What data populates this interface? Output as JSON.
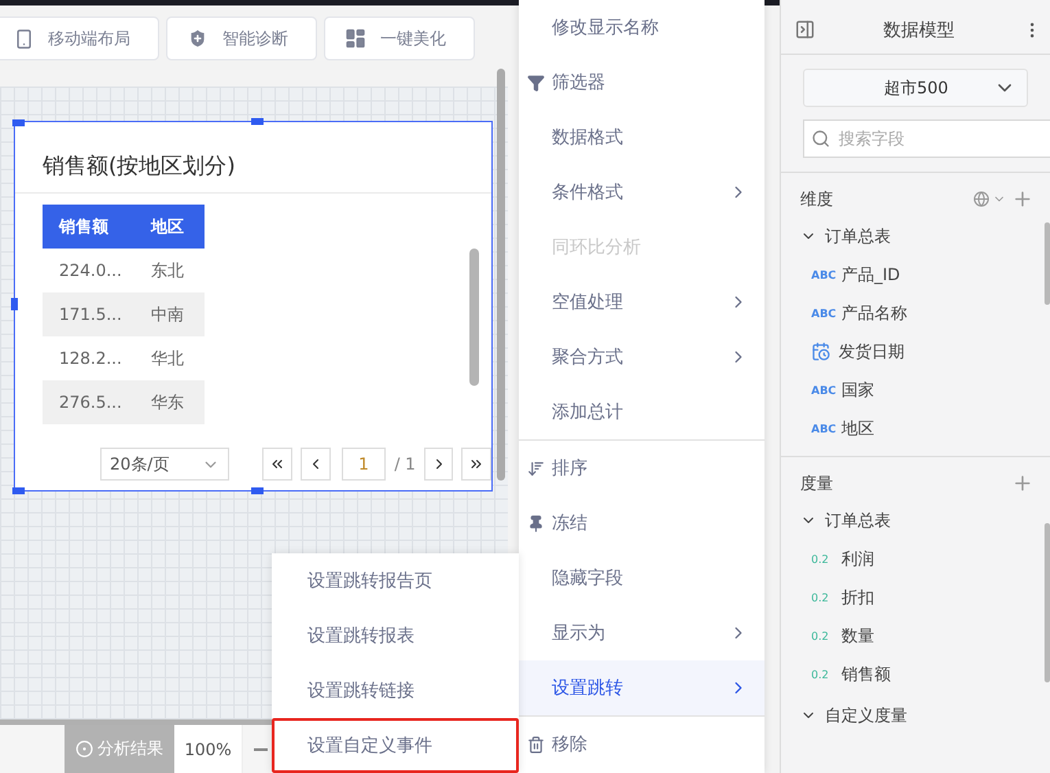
{
  "toolbar": {
    "buttons": [
      {
        "label": "移动端布局",
        "kind": "phone"
      },
      {
        "label": "智能诊断",
        "kind": "shield"
      },
      {
        "label": "一键美化",
        "kind": "layout"
      }
    ]
  },
  "card": {
    "title": "销售额(按地区划分)",
    "columns": [
      "销售额",
      "地区"
    ],
    "rows": [
      [
        "224.0...",
        "东北"
      ],
      [
        "171.5...",
        "中南"
      ],
      [
        "128.2...",
        "华北"
      ],
      [
        "276.5...",
        "华东"
      ]
    ],
    "pagination": {
      "page_size": "20条/页",
      "page": "1",
      "total": "/ 1"
    }
  },
  "bottom_bar": {
    "analysis": "分析结果",
    "zoom": "100%"
  },
  "menu": {
    "groups": [
      [
        {
          "label": "修改显示名称",
          "kind": "plain",
          "submenu": false,
          "disabled": false,
          "selected": false
        },
        {
          "label": "筛选器",
          "kind": "filter",
          "submenu": false,
          "disabled": false,
          "selected": false
        },
        {
          "label": "数据格式",
          "kind": "plain",
          "submenu": false,
          "disabled": false,
          "selected": false
        },
        {
          "label": "条件格式",
          "kind": "plain",
          "submenu": true,
          "disabled": false,
          "selected": false
        },
        {
          "label": "同环比分析",
          "kind": "plain",
          "submenu": false,
          "disabled": true,
          "selected": false
        },
        {
          "label": "空值处理",
          "kind": "plain",
          "submenu": true,
          "disabled": false,
          "selected": false
        },
        {
          "label": "聚合方式",
          "kind": "plain",
          "submenu": true,
          "disabled": false,
          "selected": false
        },
        {
          "label": "添加总计",
          "kind": "plain",
          "submenu": false,
          "disabled": false,
          "selected": false
        }
      ],
      [
        {
          "label": "排序",
          "kind": "sort",
          "submenu": false,
          "disabled": false,
          "selected": false
        },
        {
          "label": "冻结",
          "kind": "pin",
          "submenu": false,
          "disabled": false,
          "selected": false
        },
        {
          "label": "隐藏字段",
          "kind": "plain",
          "submenu": false,
          "disabled": false,
          "selected": false
        },
        {
          "label": "显示为",
          "kind": "plain",
          "submenu": true,
          "disabled": false,
          "selected": false
        },
        {
          "label": "设置跳转",
          "kind": "plain",
          "submenu": true,
          "disabled": false,
          "selected": true
        }
      ],
      [
        {
          "label": "移除",
          "kind": "trash",
          "submenu": false,
          "disabled": false,
          "selected": false
        }
      ]
    ]
  },
  "submenu": {
    "items": [
      {
        "label": "设置跳转报告页",
        "highlighted": false
      },
      {
        "label": "设置跳转报表",
        "highlighted": false
      },
      {
        "label": "设置跳转链接",
        "highlighted": false
      },
      {
        "label": "设置自定义事件",
        "highlighted": true
      }
    ]
  },
  "data_panel": {
    "title": "数据模型",
    "dataset": "超市500",
    "search": {
      "placeholder": "搜索字段"
    },
    "sections": [
      {
        "title": "维度",
        "globe": true,
        "groups": [
          {
            "name": "订单总表",
            "expanded": true,
            "fields": [
              {
                "label": "产品_ID",
                "kind": "text",
                "badge": "ABC"
              },
              {
                "label": "产品名称",
                "kind": "text",
                "badge": "ABC"
              },
              {
                "label": "发货日期",
                "kind": "date"
              },
              {
                "label": "国家",
                "kind": "text",
                "badge": "ABC"
              },
              {
                "label": "地区",
                "kind": "text",
                "badge": "ABC"
              }
            ]
          }
        ]
      },
      {
        "title": "度量",
        "globe": false,
        "groups": [
          {
            "name": "订单总表",
            "expanded": true,
            "fields": [
              {
                "label": "利润",
                "kind": "number",
                "badge": "0.2"
              },
              {
                "label": "折扣",
                "kind": "number",
                "badge": "0.2"
              },
              {
                "label": "数量",
                "kind": "number",
                "badge": "0.2"
              },
              {
                "label": "销售额",
                "kind": "number",
                "badge": "0.2"
              }
            ]
          },
          {
            "name": "自定义度量",
            "expanded": true
          }
        ]
      }
    ]
  }
}
